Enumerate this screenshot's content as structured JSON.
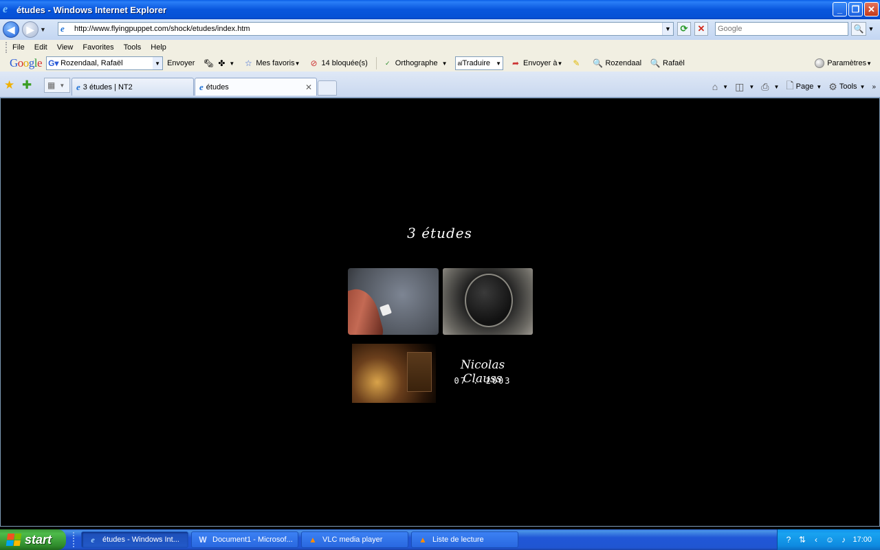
{
  "window": {
    "title": "études - Windows Internet Explorer",
    "controls": {
      "minimize": "_",
      "maximize": "❐",
      "close": "✕"
    }
  },
  "address_bar": {
    "url": "http://www.flyingpuppet.com/shock/etudes/index.htm",
    "search_placeholder": "Google"
  },
  "menu": {
    "items": [
      "File",
      "Edit",
      "View",
      "Favorites",
      "Tools",
      "Help"
    ]
  },
  "google_toolbar": {
    "logo": {
      "G": "G",
      "o1": "o",
      "o2": "o",
      "g": "g",
      "l": "l",
      "e": "e"
    },
    "search_value": "Rozendaal, Rafaël",
    "envoyer": "Envoyer",
    "mes_favoris": "Mes favoris",
    "blocked": "14 bloquée(s)",
    "orthographe": "Orthographe",
    "traduire": "Traduire",
    "envoyer_a": "Envoyer à",
    "highlight1": "Rozendaal",
    "highlight2": "Rafaël",
    "parametres": "Paramètres"
  },
  "tabs": {
    "items": [
      {
        "label": "3 études | NT2"
      },
      {
        "label": "études"
      }
    ],
    "command_bar": {
      "page": "Page",
      "tools": "Tools"
    }
  },
  "page": {
    "title": "3 études",
    "author": "Nicolas Clauss",
    "date": "07 . 2003"
  },
  "taskbar": {
    "start": "start",
    "tasks": [
      {
        "label": "études - Windows Int...",
        "icon": "ie-icon",
        "active": true
      },
      {
        "label": "Document1 - Microsof...",
        "icon": "word-icon",
        "active": false
      },
      {
        "label": "VLC media player",
        "icon": "vlc-icon",
        "active": false
      },
      {
        "label": "Liste de lecture",
        "icon": "vlc-icon",
        "active": false
      }
    ],
    "clock": "17:00"
  }
}
